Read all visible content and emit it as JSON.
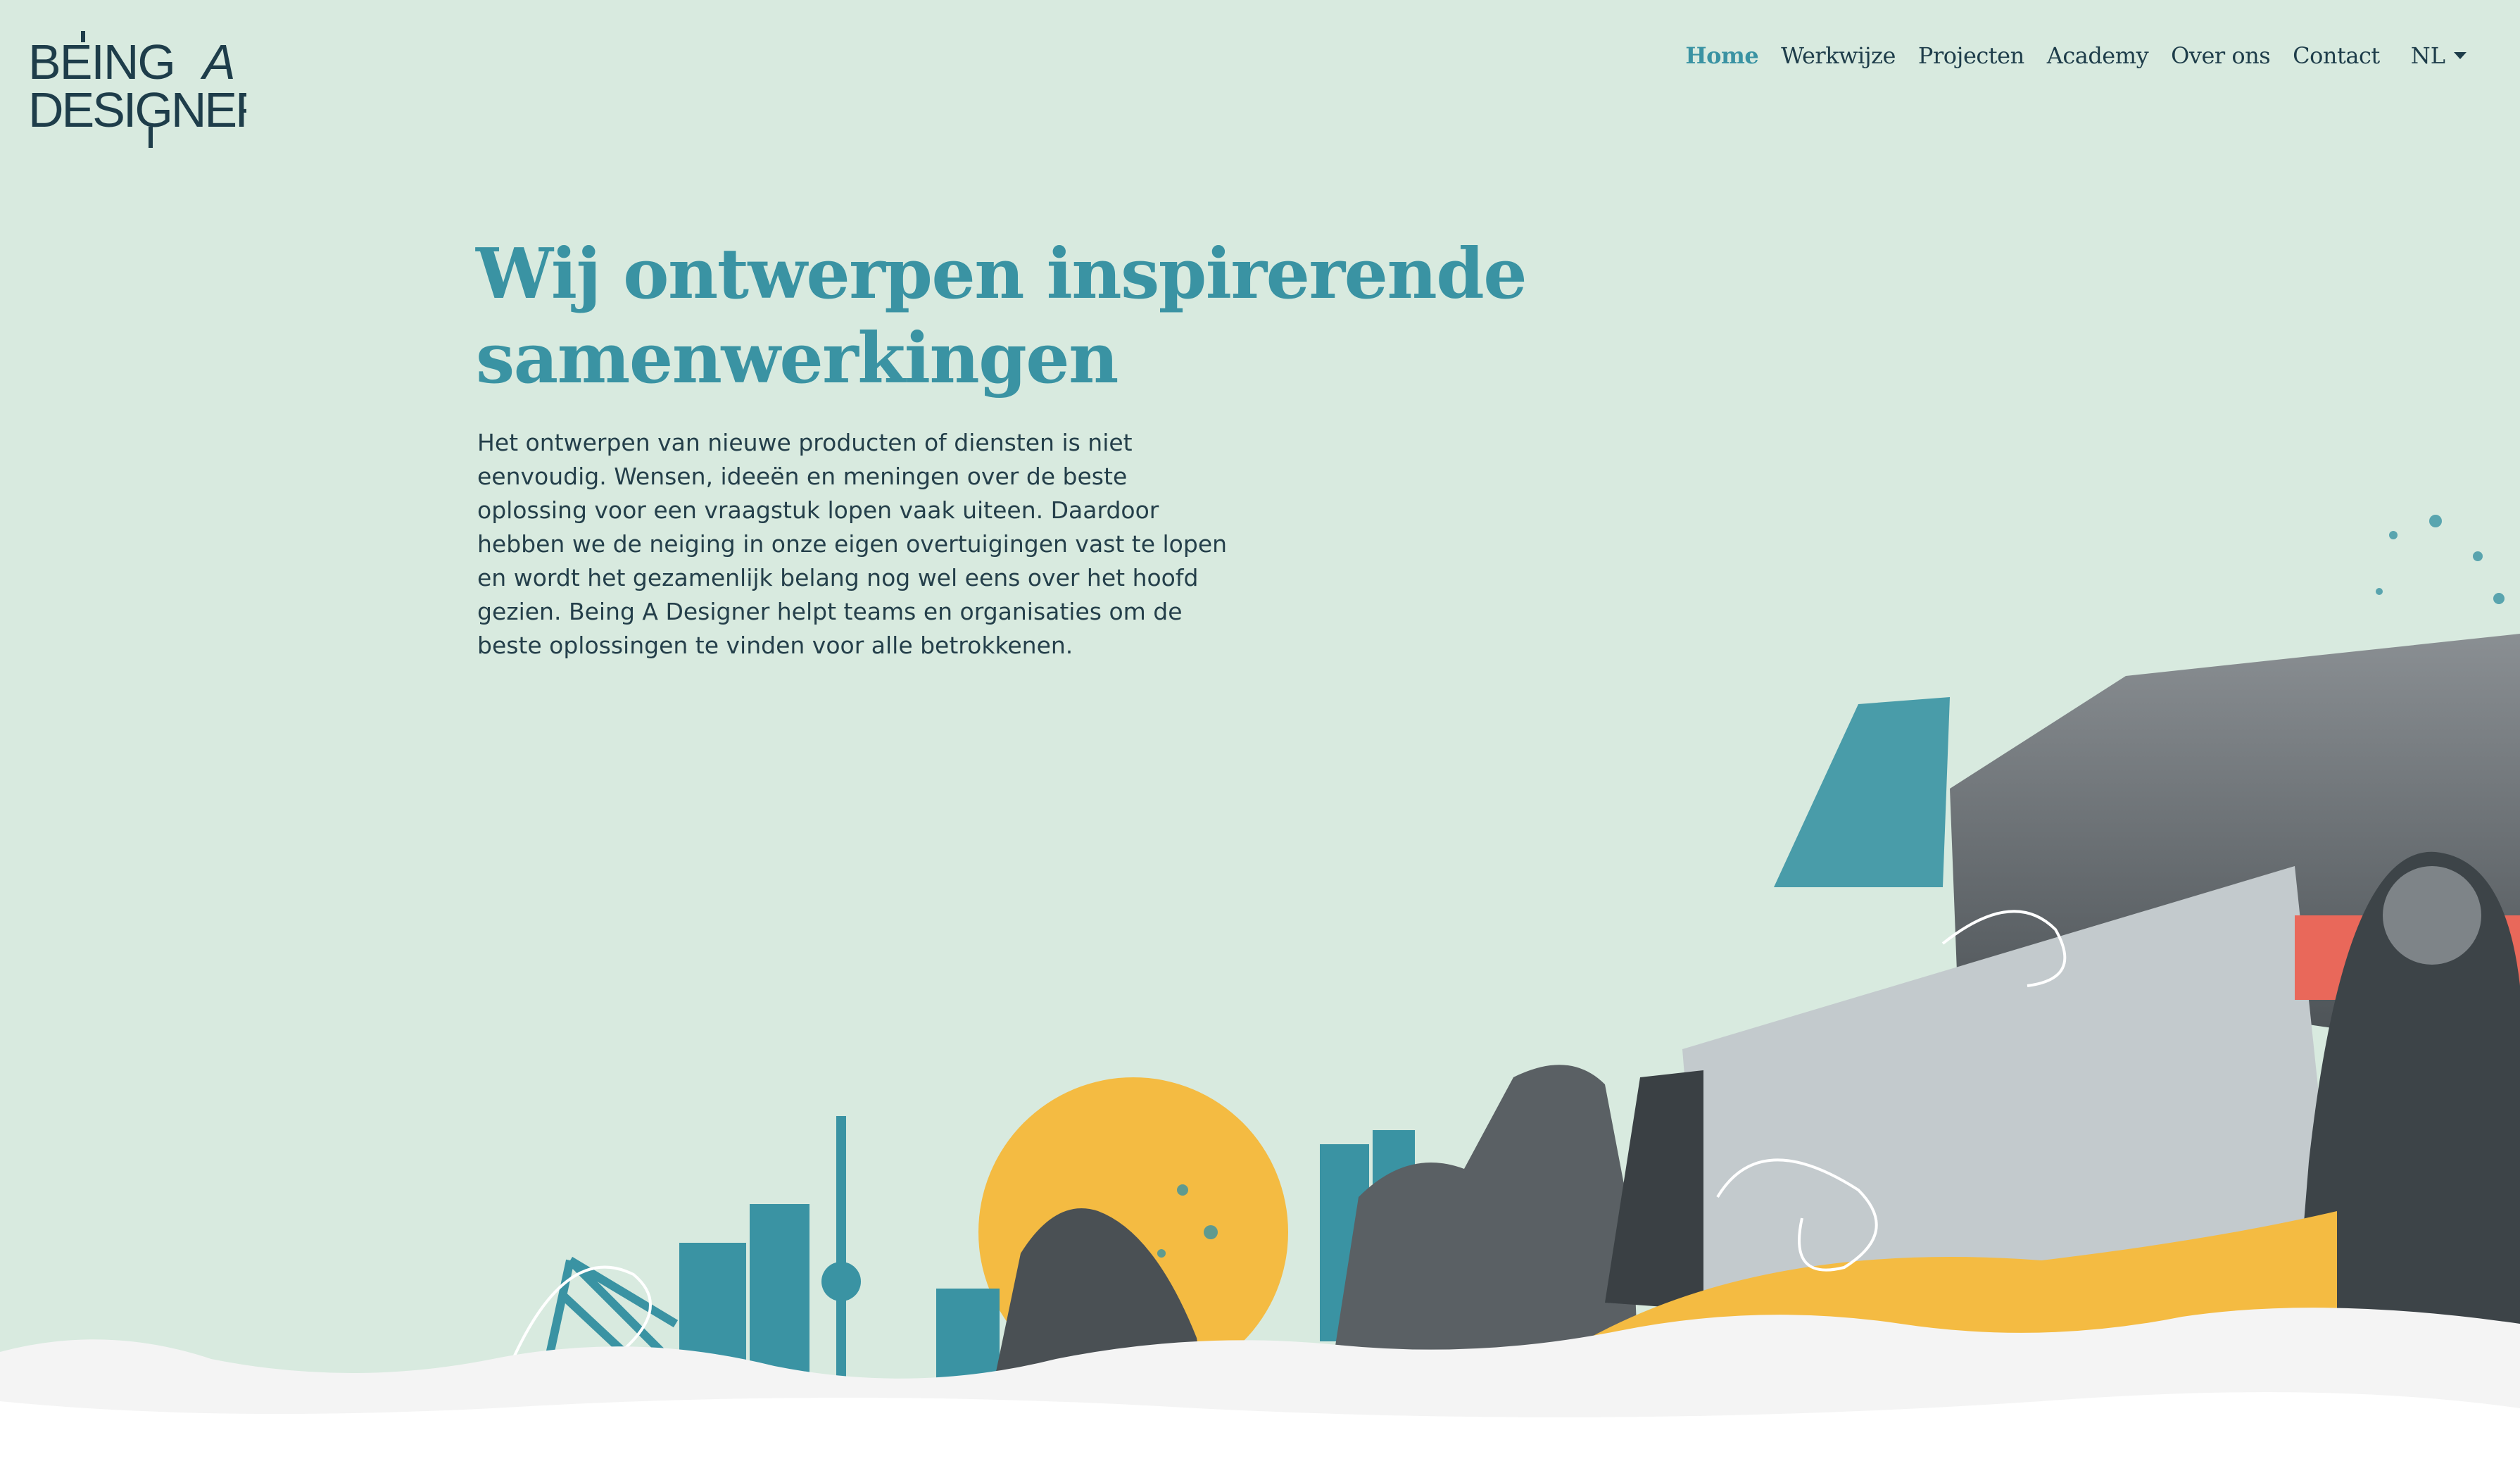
{
  "brand": {
    "logo_line1": "BEING",
    "logo_a": "A",
    "logo_line2": "DESIGNER",
    "logo_color": "#1e3d4a"
  },
  "nav": {
    "items": [
      {
        "label": "Home",
        "active": true
      },
      {
        "label": "Werkwijze",
        "active": false
      },
      {
        "label": "Projecten",
        "active": false
      },
      {
        "label": "Academy",
        "active": false
      },
      {
        "label": "Over ons",
        "active": false
      },
      {
        "label": "Contact",
        "active": false
      }
    ],
    "language": "NL"
  },
  "hero": {
    "title_line1": "Wij ontwerpen inspirerende",
    "title_line2": "samenwerkingen",
    "body": "Het ontwerpen van nieuwe producten of diensten is niet eenvoudig. Wensen, ideeën en meningen over de beste oplossing voor een vraagstuk lopen vaak uiteen. Daardoor hebben we de neiging in onze eigen overtuigingen vast te lopen en wordt het gezamenlijk belang nog wel eens over het hoofd gezien. Being A Designer helpt teams en organisaties om de beste oplossingen te vinden voor alle betrokkenen."
  },
  "colors": {
    "background": "#d8eadf",
    "accent_teal": "#3a93a3",
    "sun_yellow": "#f4bb42",
    "coral": "#e9685a",
    "dark_text": "#1e3d4a"
  },
  "icons": [
    "caret-down-icon"
  ]
}
